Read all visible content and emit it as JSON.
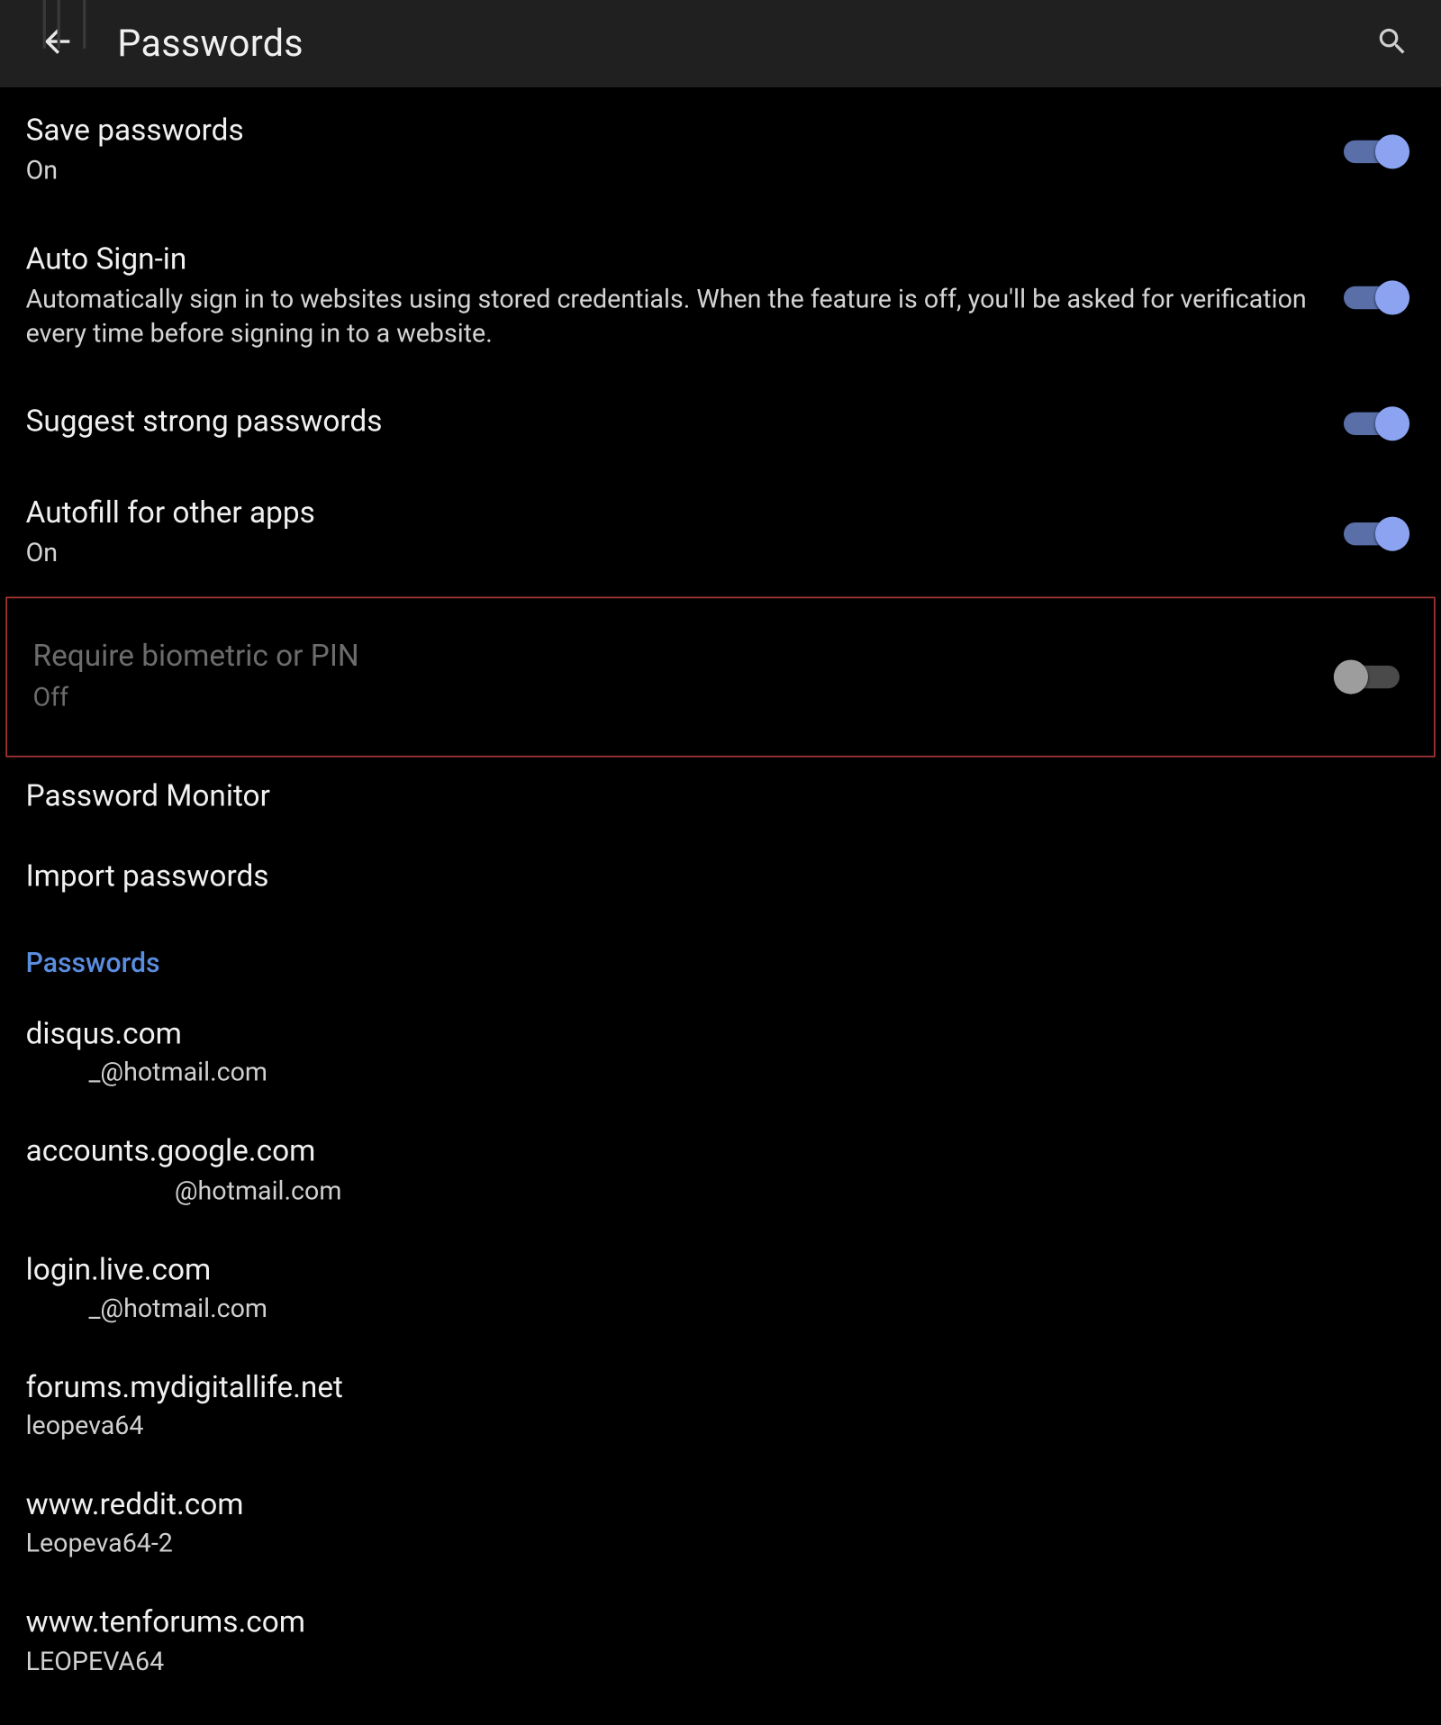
{
  "header": {
    "title": "Passwords"
  },
  "settings": {
    "save_passwords": {
      "title": "Save passwords",
      "sub": "On",
      "on": true
    },
    "auto_signin": {
      "title": "Auto Sign-in",
      "sub": "Automatically sign in to websites using stored credentials. When the feature is off, you'll be asked for verification every time before signing in to a website.",
      "on": true
    },
    "suggest_strong": {
      "title": "Suggest strong passwords",
      "on": true
    },
    "autofill_other": {
      "title": "Autofill for other apps",
      "sub": "On",
      "on": true
    },
    "require_bio": {
      "title": "Require biometric or PIN",
      "sub": "Off",
      "on": false
    },
    "password_monitor": {
      "title": "Password Monitor"
    },
    "import_passwords": {
      "title": "Import passwords"
    }
  },
  "section_label": "Passwords",
  "passwords": [
    {
      "site": "disqus.com",
      "user": "_@hotmail.com",
      "indent": "indent1"
    },
    {
      "site": "accounts.google.com",
      "user": "@hotmail.com",
      "indent": "indent2"
    },
    {
      "site": "login.live.com",
      "user": "_@hotmail.com",
      "indent": "indent1"
    },
    {
      "site": "forums.mydigitallife.net",
      "user": "leopeva64",
      "indent": ""
    },
    {
      "site": "www.reddit.com",
      "user": "Leopeva64-2",
      "indent": ""
    },
    {
      "site": "www.tenforums.com",
      "user": "LEOPEVA64",
      "indent": ""
    }
  ]
}
